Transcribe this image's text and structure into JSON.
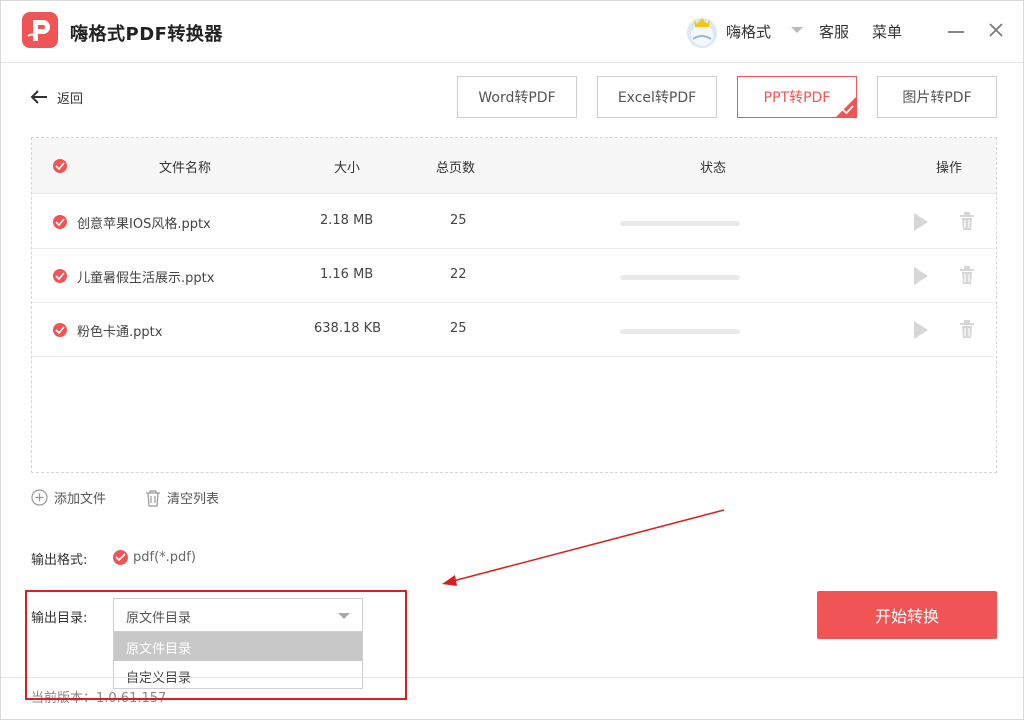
{
  "app": {
    "title": "嗨格式PDF转换器",
    "user_name": "嗨格式",
    "service_label": "客服",
    "menu_label": "菜单"
  },
  "colors": {
    "accent": "#f05454",
    "annotation": "#d92020"
  },
  "toolbar": {
    "back_label": "返回",
    "tabs": [
      {
        "label": "Word转PDF",
        "active": false
      },
      {
        "label": "Excel转PDF",
        "active": false
      },
      {
        "label": "PPT转PDF",
        "active": true
      },
      {
        "label": "图片转PDF",
        "active": false
      }
    ]
  },
  "table": {
    "headers": {
      "name": "文件名称",
      "size": "大小",
      "pages": "总页数",
      "status": "状态",
      "actions": "操作"
    },
    "rows": [
      {
        "name": "创意苹果IOS风格.pptx",
        "size": "2.18 MB",
        "pages": "25",
        "progress": 0
      },
      {
        "name": "儿童暑假生活展示.pptx",
        "size": "1.16 MB",
        "pages": "22",
        "progress": 0
      },
      {
        "name": "粉色卡通.pptx",
        "size": "638.18 KB",
        "pages": "25",
        "progress": 0
      }
    ]
  },
  "actions": {
    "add_file": "添加文件",
    "clear_list": "清空列表"
  },
  "output": {
    "format_label": "输出格式:",
    "format_value": "pdf(*.pdf)",
    "dir_label": "输出目录:",
    "dir_value": "原文件目录",
    "dir_options": [
      "原文件目录",
      "自定义目录"
    ]
  },
  "start_button": "开始转换",
  "version": "当前版本：1.0.61.157",
  "icons": {
    "logo": "pdf-logo-icon",
    "back": "arrow-left-icon",
    "check": "check-circle-icon",
    "play": "play-icon",
    "trash": "trash-icon",
    "add": "plus-circle-icon",
    "clear": "trash-icon",
    "close": "close-icon",
    "minimize": "minimize-icon"
  }
}
